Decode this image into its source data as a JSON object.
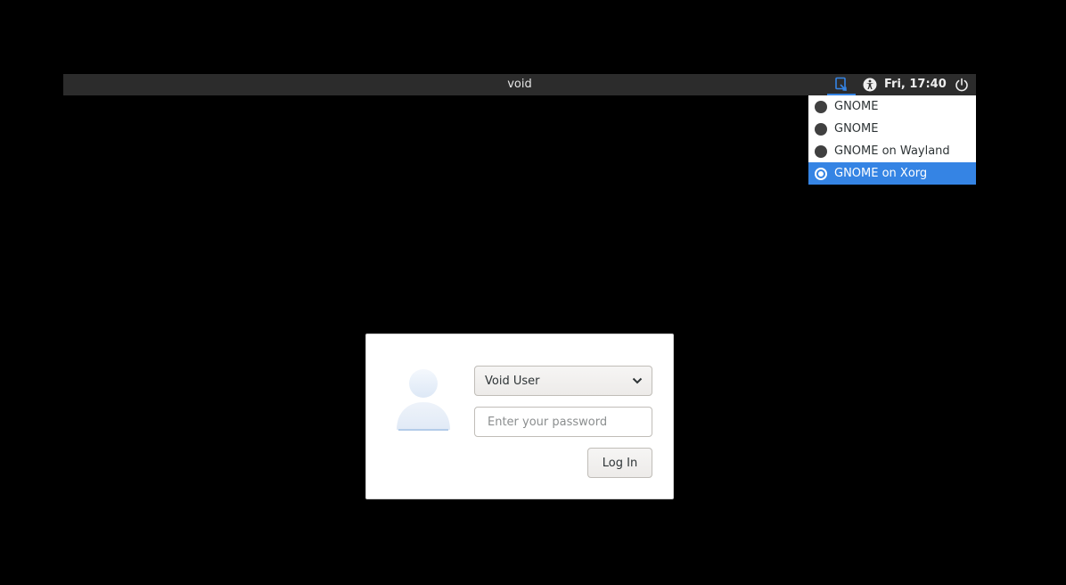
{
  "topbar": {
    "hostname": "void",
    "clock": "Fri, 17:40",
    "icons": {
      "session": "session-selector-icon",
      "accessibility": "accessibility-icon",
      "power": "power-icon"
    }
  },
  "session_menu": {
    "items": [
      {
        "label": "GNOME",
        "selected": false
      },
      {
        "label": "GNOME",
        "selected": false
      },
      {
        "label": "GNOME on Wayland",
        "selected": false
      },
      {
        "label": "GNOME on Xorg",
        "selected": true
      }
    ]
  },
  "login": {
    "user_select": {
      "value": "Void User"
    },
    "password": {
      "placeholder": "Enter your password",
      "value": ""
    },
    "login_button": "Log In"
  },
  "colors": {
    "accent": "#3584e4",
    "background": "#000000",
    "topbar": "#2c2c2c"
  }
}
